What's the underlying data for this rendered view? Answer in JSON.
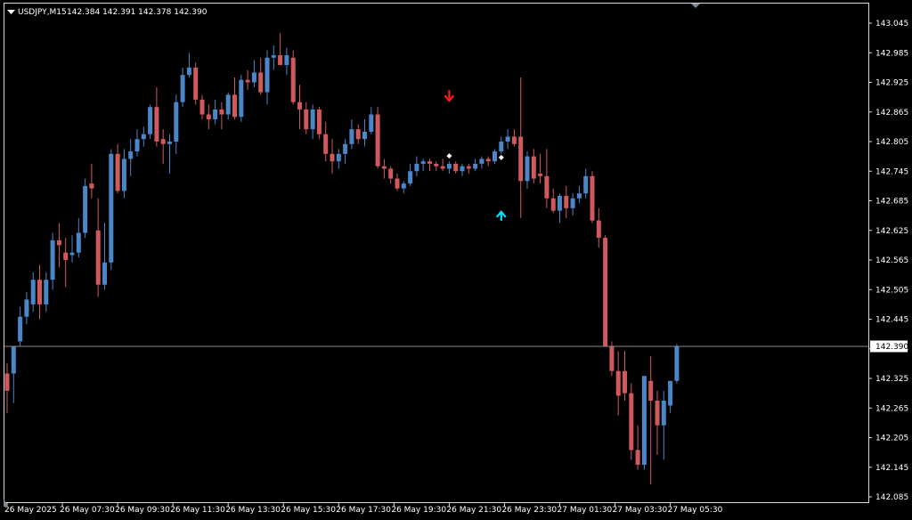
{
  "chart_data": {
    "type": "candlestick",
    "title": "USDJPY,M15",
    "ohlc_text": "142.384 142.391 142.378 142.390",
    "ylim": [
      142.085,
      143.045
    ],
    "yticks": [
      "143.045",
      "142.985",
      "142.925",
      "142.865",
      "142.805",
      "142.745",
      "142.685",
      "142.625",
      "142.565",
      "142.505",
      "142.445",
      "142.385",
      "142.325",
      "142.265",
      "142.205",
      "142.145",
      "142.085"
    ],
    "xticks": [
      "26 May 2025",
      "26 May 07:30",
      "26 May 09:30",
      "26 May 11:30",
      "26 May 13:30",
      "26 May 15:30",
      "26 May 17:30",
      "26 May 19:30",
      "26 May 21:30",
      "26 May 23:30",
      "27 May 01:30",
      "27 May 03:30",
      "27 May 05:30"
    ],
    "current_price": "142.390",
    "colors": {
      "bull": "#4a86c8",
      "bear": "#d0595e",
      "doji": "#2fb52f",
      "grid_line": "#8a8a8a",
      "price_label_bg": "#ffffff",
      "down_arrow": "#ff1a1a",
      "up_arrow": "#00e5ff"
    },
    "candles": [
      [
        142.335,
        142.355,
        142.255,
        142.3
      ],
      [
        142.335,
        142.39,
        142.275,
        142.39
      ],
      [
        142.4,
        142.47,
        142.39,
        142.45
      ],
      [
        142.45,
        142.5,
        142.435,
        142.485
      ],
      [
        142.475,
        142.54,
        142.46,
        142.525
      ],
      [
        142.525,
        142.555,
        142.445,
        142.475
      ],
      [
        142.475,
        142.54,
        142.46,
        142.525
      ],
      [
        142.525,
        142.62,
        142.505,
        142.605
      ],
      [
        142.605,
        142.64,
        142.55,
        142.595
      ],
      [
        142.58,
        142.61,
        142.51,
        142.565
      ],
      [
        142.575,
        142.615,
        142.56,
        142.58
      ],
      [
        142.58,
        142.65,
        142.57,
        142.62
      ],
      [
        142.62,
        142.73,
        142.61,
        142.715
      ],
      [
        142.72,
        142.76,
        142.69,
        142.71
      ],
      [
        142.625,
        142.69,
        142.49,
        142.515
      ],
      [
        142.515,
        142.64,
        142.505,
        142.56
      ],
      [
        142.56,
        142.79,
        142.545,
        142.78
      ],
      [
        142.78,
        142.8,
        142.7,
        142.705
      ],
      [
        142.705,
        142.79,
        142.69,
        142.77
      ],
      [
        142.77,
        142.81,
        142.735,
        142.785
      ],
      [
        142.785,
        142.83,
        142.775,
        142.81
      ],
      [
        142.81,
        142.835,
        142.795,
        142.82
      ],
      [
        142.82,
        142.88,
        142.81,
        142.875
      ],
      [
        142.875,
        142.915,
        142.795,
        142.805
      ],
      [
        142.81,
        142.83,
        142.76,
        142.8
      ],
      [
        142.8,
        142.82,
        142.74,
        142.805
      ],
      [
        142.805,
        142.9,
        142.78,
        142.885
      ],
      [
        142.885,
        142.955,
        142.875,
        142.94
      ],
      [
        142.94,
        142.985,
        142.935,
        142.955
      ],
      [
        142.955,
        142.965,
        142.88,
        142.89
      ],
      [
        142.89,
        142.9,
        142.85,
        142.86
      ],
      [
        142.86,
        142.88,
        142.83,
        142.85
      ],
      [
        142.85,
        142.89,
        142.84,
        142.87
      ],
      [
        142.87,
        142.885,
        142.83,
        142.86
      ],
      [
        142.86,
        142.905,
        142.85,
        142.9
      ],
      [
        142.9,
        142.935,
        142.85,
        142.855
      ],
      [
        142.855,
        142.94,
        142.845,
        142.93
      ],
      [
        142.93,
        142.95,
        142.91,
        142.925
      ],
      [
        142.925,
        142.97,
        142.915,
        142.945
      ],
      [
        142.945,
        142.975,
        142.9,
        142.905
      ],
      [
        142.905,
        142.99,
        142.88,
        142.975
      ],
      [
        142.975,
        143.0,
        142.95,
        142.98
      ],
      [
        142.98,
        143.025,
        142.965,
        142.96
      ],
      [
        142.96,
        142.995,
        142.94,
        142.98
      ],
      [
        142.975,
        142.99,
        142.88,
        142.885
      ],
      [
        142.885,
        142.92,
        142.83,
        142.87
      ],
      [
        142.87,
        142.885,
        142.82,
        142.83
      ],
      [
        142.83,
        142.88,
        142.81,
        142.87
      ],
      [
        142.87,
        142.875,
        142.81,
        142.82
      ],
      [
        142.82,
        142.845,
        142.765,
        142.78
      ],
      [
        142.78,
        142.81,
        142.74,
        142.765
      ],
      [
        142.765,
        142.79,
        142.75,
        142.78
      ],
      [
        142.78,
        142.81,
        142.76,
        142.8
      ],
      [
        142.8,
        142.85,
        142.79,
        142.83
      ],
      [
        142.83,
        142.84,
        142.8,
        142.81
      ],
      [
        142.81,
        142.85,
        142.795,
        142.825
      ],
      [
        142.825,
        142.875,
        142.82,
        142.86
      ],
      [
        142.86,
        142.875,
        142.75,
        142.755
      ],
      [
        142.755,
        142.77,
        142.73,
        142.75
      ],
      [
        142.75,
        142.755,
        142.72,
        142.73
      ],
      [
        142.73,
        142.74,
        142.705,
        142.71
      ],
      [
        142.71,
        142.725,
        142.7,
        142.72
      ],
      [
        142.72,
        142.76,
        142.715,
        142.745
      ],
      [
        142.745,
        142.775,
        142.735,
        142.76
      ],
      [
        142.76,
        142.77,
        142.745,
        142.765
      ],
      [
        142.765,
        142.77,
        142.745,
        142.76
      ],
      [
        142.76,
        142.765,
        142.745,
        142.755
      ],
      [
        142.755,
        142.77,
        142.745,
        142.75
      ],
      [
        142.75,
        142.765,
        142.74,
        142.76
      ],
      [
        142.76,
        142.765,
        142.74,
        142.745
      ],
      [
        142.745,
        142.76,
        142.735,
        142.755
      ],
      [
        142.755,
        142.76,
        142.74,
        142.75
      ],
      [
        142.75,
        142.77,
        142.745,
        142.76
      ],
      [
        142.76,
        142.775,
        142.75,
        142.77
      ],
      [
        142.77,
        142.775,
        142.755,
        142.765
      ],
      [
        142.765,
        142.79,
        142.76,
        142.785
      ],
      [
        142.785,
        142.815,
        142.78,
        142.805
      ],
      [
        142.805,
        142.83,
        142.79,
        142.815
      ],
      [
        142.815,
        142.83,
        142.795,
        142.8
      ],
      [
        142.815,
        142.935,
        142.65,
        142.725
      ],
      [
        142.725,
        142.785,
        142.71,
        142.775
      ],
      [
        142.775,
        142.79,
        142.72,
        142.73
      ],
      [
        142.74,
        142.78,
        142.72,
        142.735
      ],
      [
        142.735,
        142.79,
        142.67,
        142.69
      ],
      [
        142.69,
        142.71,
        142.66,
        142.665
      ],
      [
        142.665,
        142.7,
        142.64,
        142.695
      ],
      [
        142.695,
        142.715,
        142.65,
        142.67
      ],
      [
        142.67,
        142.7,
        142.655,
        142.69
      ],
      [
        142.69,
        142.715,
        142.68,
        142.7
      ],
      [
        142.7,
        142.75,
        142.69,
        142.735
      ],
      [
        142.735,
        142.745,
        142.64,
        142.645
      ],
      [
        142.645,
        142.67,
        142.59,
        142.61
      ],
      [
        142.61,
        142.615,
        142.39,
        142.39
      ],
      [
        142.39,
        142.4,
        142.33,
        142.34
      ],
      [
        142.34,
        142.38,
        142.25,
        142.29
      ],
      [
        142.34,
        142.38,
        142.28,
        142.295
      ],
      [
        142.295,
        142.315,
        142.16,
        142.18
      ],
      [
        142.18,
        142.23,
        142.14,
        142.15
      ],
      [
        142.15,
        142.33,
        142.14,
        142.33
      ],
      [
        142.32,
        142.37,
        142.11,
        142.28
      ],
      [
        142.28,
        142.3,
        142.17,
        142.23
      ],
      [
        142.23,
        142.3,
        142.16,
        142.28
      ],
      [
        142.27,
        142.32,
        142.255,
        142.32
      ],
      [
        142.32,
        142.395,
        142.315,
        142.39
      ]
    ],
    "arrows": [
      {
        "dir": "down",
        "index": 68
      },
      {
        "dir": "up",
        "index": 76
      }
    ],
    "dots": [
      68,
      76
    ]
  }
}
